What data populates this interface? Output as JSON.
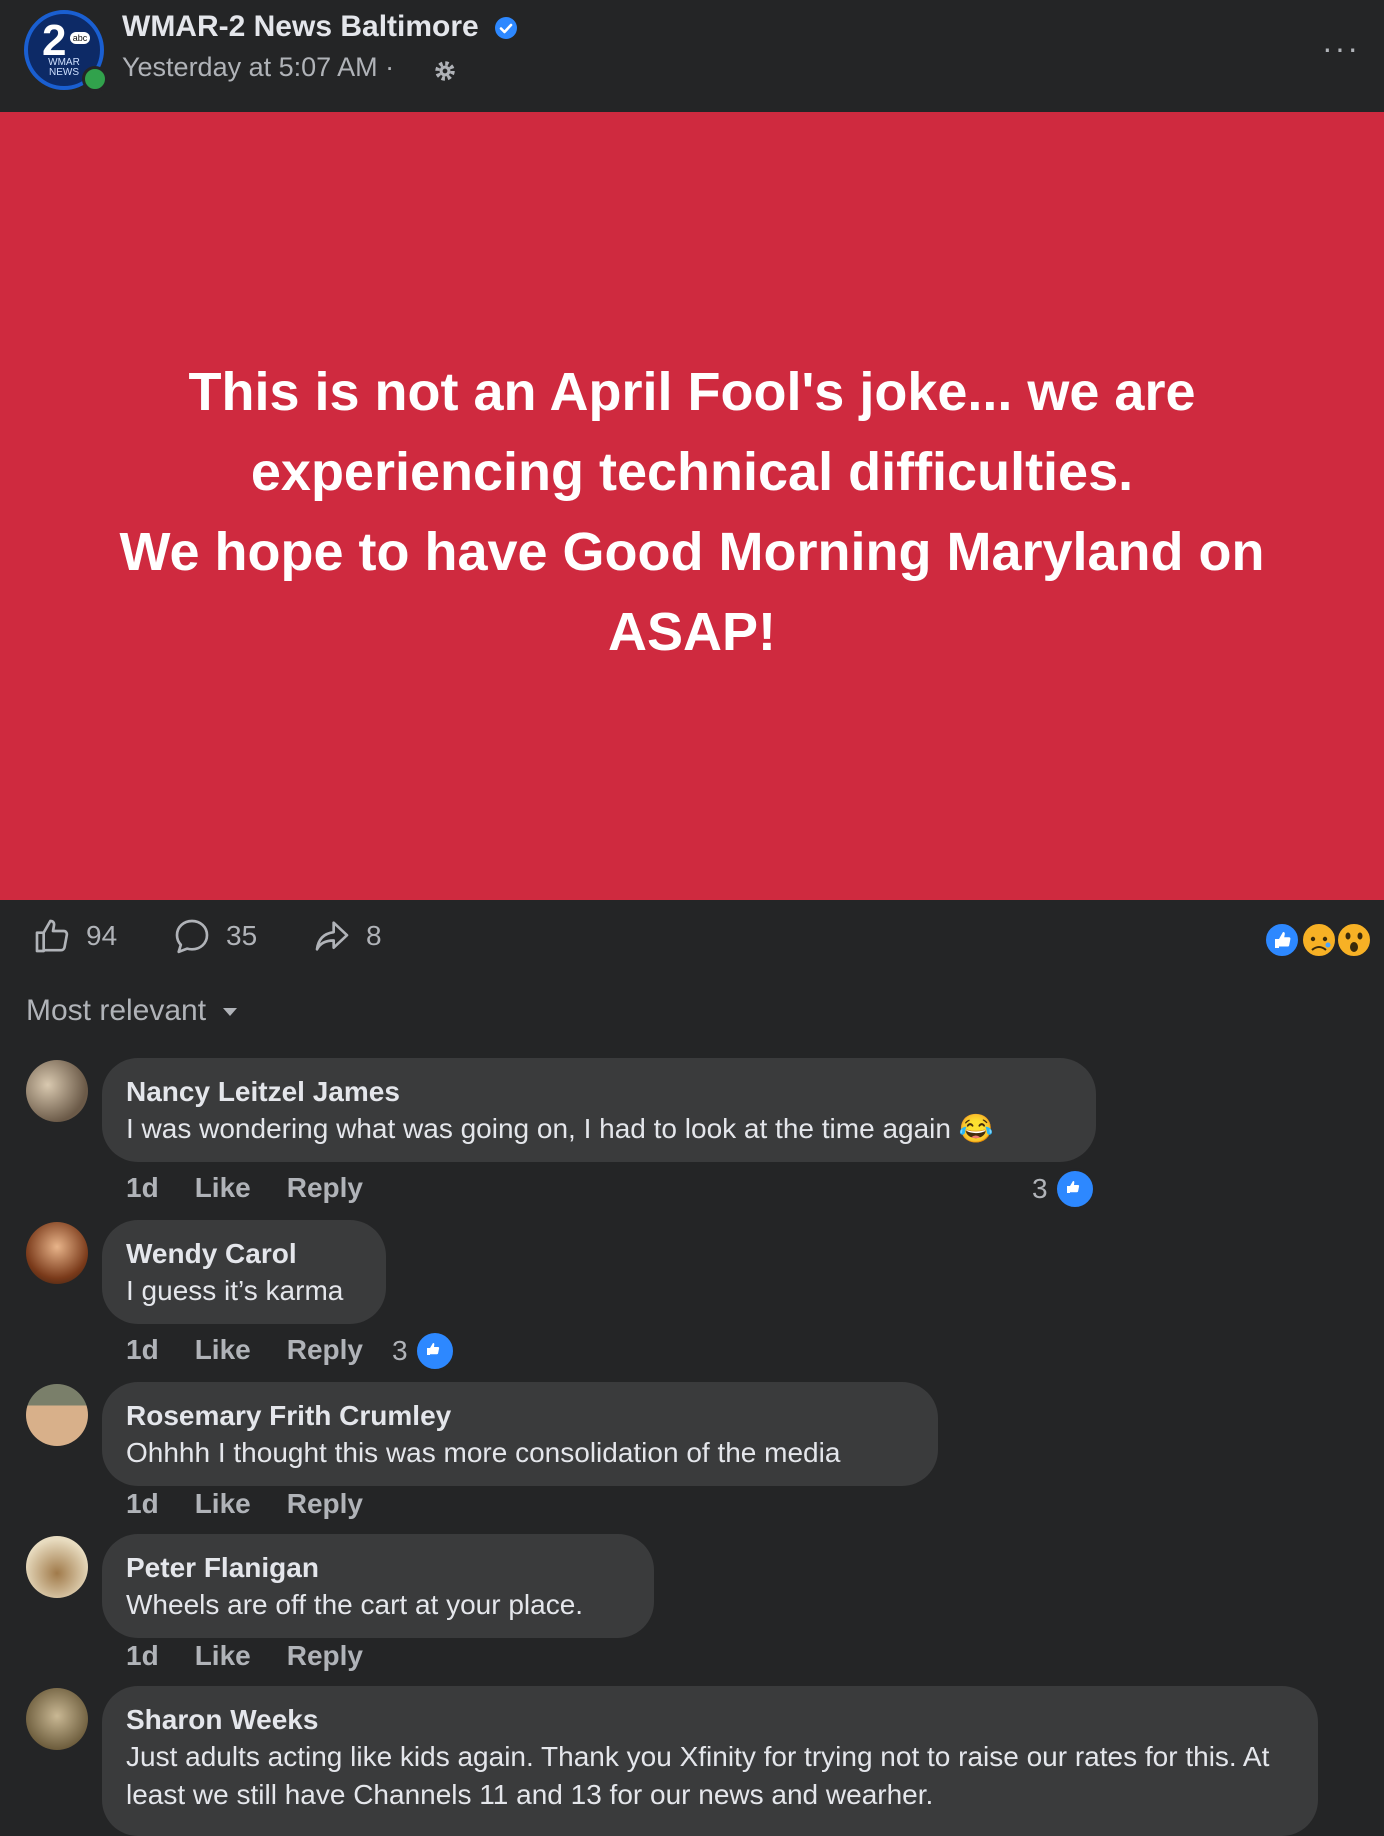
{
  "header": {
    "page_name": "WMAR-2 News Baltimore",
    "timestamp": "Yesterday at 5:07 AM ·",
    "avatar_number": "2",
    "avatar_abc": "abc",
    "avatar_text": "WMAR NEWS",
    "more_label": "···"
  },
  "post": {
    "lines": [
      "This is not an April Fool's joke... we are",
      "experiencing technical difficulties.",
      "We hope to have Good Morning Maryland on",
      "ASAP!"
    ],
    "background_color": "#cf2a3f"
  },
  "actions": {
    "likes": "94",
    "comments": "35",
    "shares": "8"
  },
  "sort": {
    "label": "Most relevant"
  },
  "comments": [
    {
      "name": "Nancy Leitzel James",
      "text": "I was wondering what was going on, I had to look at the time again 😂",
      "time": "1d",
      "like": "Like",
      "reply": "Reply",
      "likes": "3"
    },
    {
      "name": "Wendy Carol",
      "text": "I guess it’s karma",
      "time": "1d",
      "like": "Like",
      "reply": "Reply",
      "likes": "3"
    },
    {
      "name": "Rosemary Frith Crumley",
      "text": "Ohhhh I thought this was more consolidation of the media",
      "time": "1d",
      "like": "Like",
      "reply": "Reply"
    },
    {
      "name": "Peter Flanigan",
      "text": "Wheels are off the cart at your place.",
      "time": "1d",
      "like": "Like",
      "reply": "Reply"
    },
    {
      "name": "Sharon Weeks",
      "text": "Just adults acting like kids again. Thank you Xfinity for trying not to raise our rates for this. At least we still have Channels 11 and 13 for our news and wearher.",
      "time": "",
      "like": "",
      "reply": ""
    }
  ]
}
